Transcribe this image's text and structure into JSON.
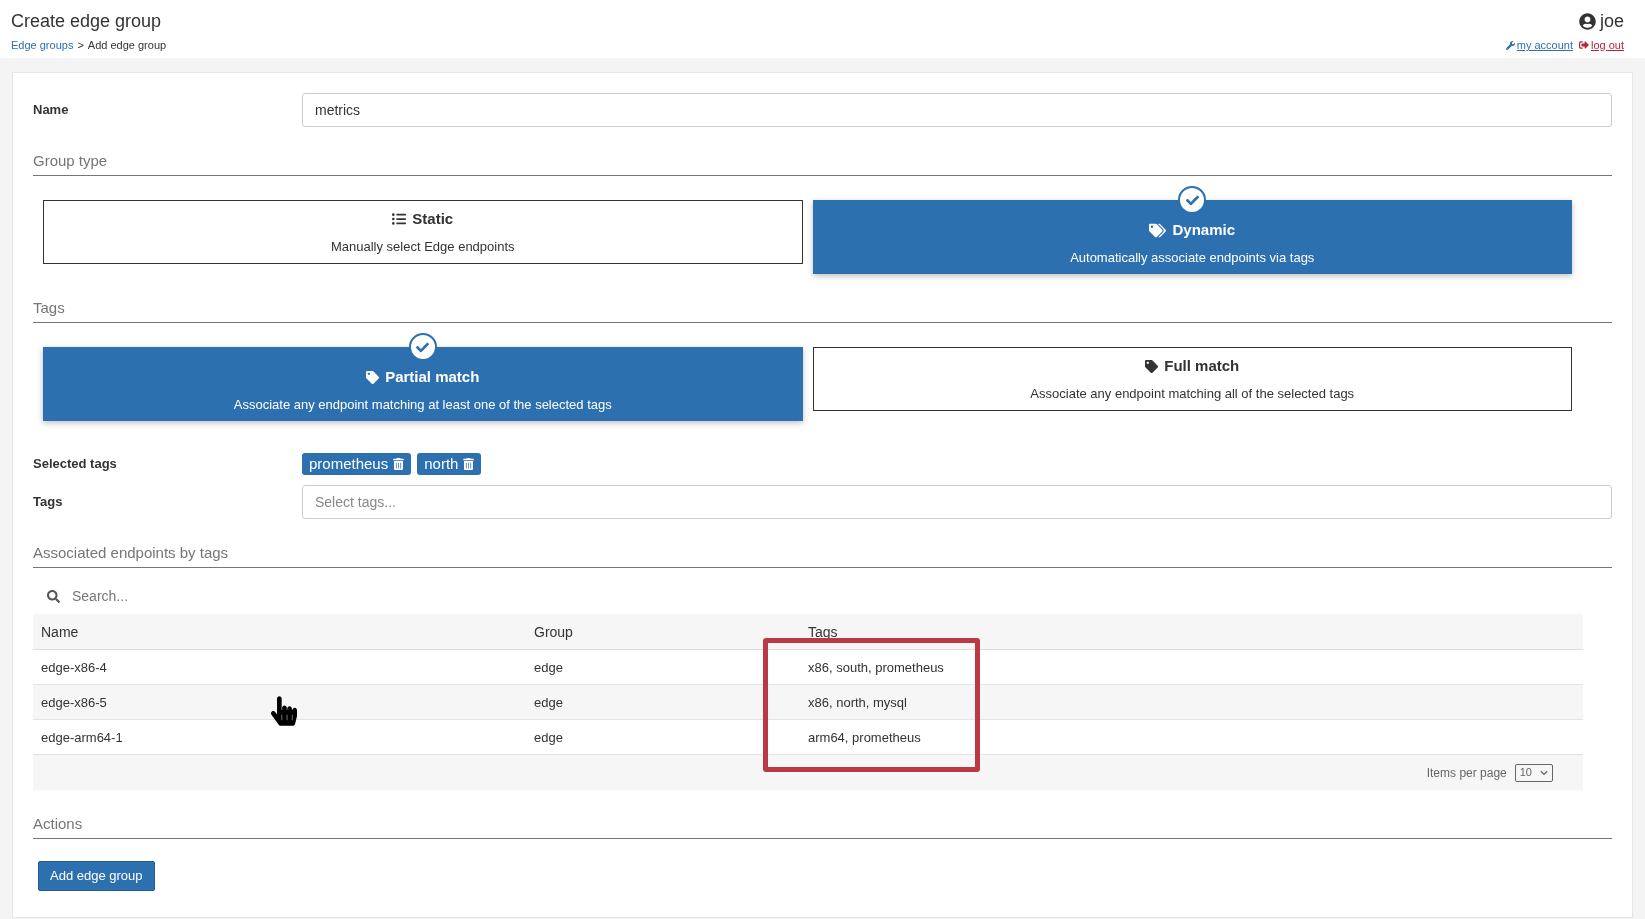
{
  "header": {
    "title": "Create edge group",
    "breadcrumb": {
      "link": "Edge groups",
      "separator": ">",
      "current": "Add edge group"
    },
    "user": "joe",
    "my_account": "my account",
    "log_out": "log out"
  },
  "name_field": {
    "label": "Name",
    "value": "metrics"
  },
  "group_type": {
    "title": "Group type",
    "options": [
      {
        "kind": "list",
        "title": "Static",
        "description": "Manually select Edge endpoints",
        "selected": false
      },
      {
        "kind": "tags",
        "title": "Dynamic",
        "description": "Automatically associate endpoints via tags",
        "selected": true
      }
    ]
  },
  "tags_mode": {
    "title": "Tags",
    "options": [
      {
        "kind": "tag",
        "title": "Partial match",
        "description": "Associate any endpoint matching at least one of the selected tags",
        "selected": true
      },
      {
        "kind": "tag",
        "title": "Full match",
        "description": "Associate any endpoint matching all of the selected tags",
        "selected": false
      }
    ]
  },
  "selected_tags": {
    "label": "Selected tags",
    "tags": [
      "prometheus",
      "north"
    ]
  },
  "tags_field": {
    "label": "Tags",
    "placeholder": "Select tags..."
  },
  "endpoints": {
    "title": "Associated endpoints by tags",
    "search_placeholder": "Search...",
    "columns": [
      {
        "label": "Name",
        "highlighted": false
      },
      {
        "label": "Group",
        "highlighted": false
      },
      {
        "label": "Tags",
        "highlighted": true
      }
    ],
    "rows": [
      [
        "edge-x86-4",
        "edge",
        "x86, south, prometheus"
      ],
      [
        "edge-x86-5",
        "edge",
        "x86, north, mysql"
      ],
      [
        "edge-arm64-1",
        "edge",
        "arm64, prometheus"
      ]
    ],
    "items_per_page_label": "Items per page",
    "items_per_page": "10"
  },
  "actions": {
    "title": "Actions",
    "button": "Add edge group"
  }
}
